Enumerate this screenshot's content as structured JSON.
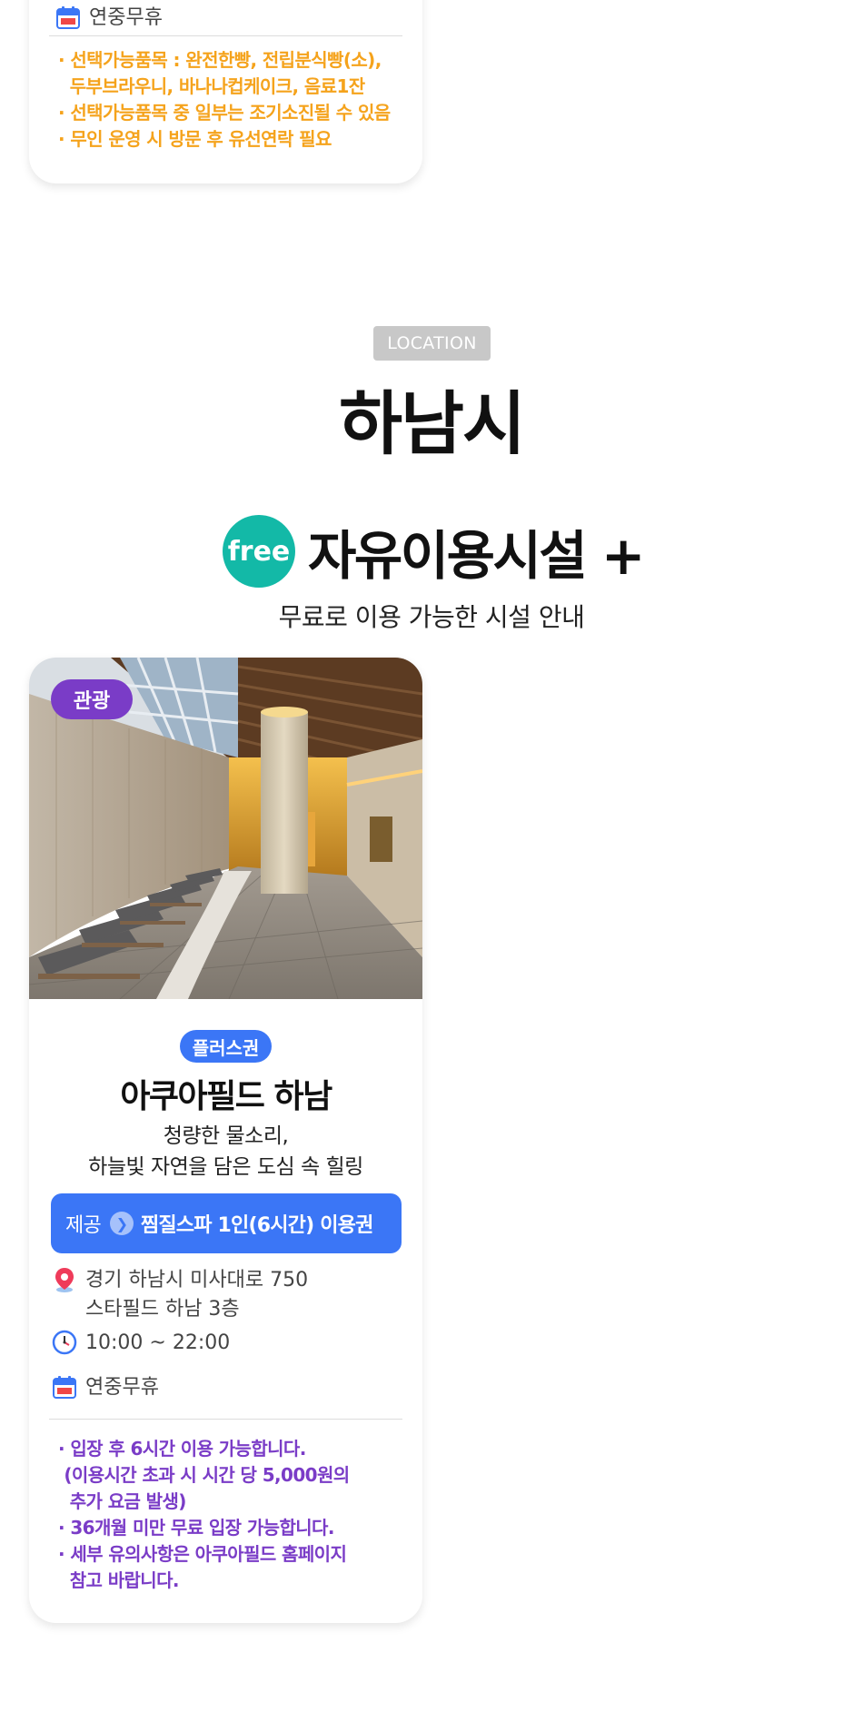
{
  "top_card": {
    "closed_text": "연중무휴",
    "notes": [
      "· 선택가능품목 : 완전한빵, 전립분식빵(소),",
      "  두부브라우니, 바나나컵케이크, 음료1잔",
      "· 선택가능품목 중 일부는 조기소진될 수 있음",
      "· 무인 운영 시 방문 후 유선연락 필요"
    ],
    "note_color": "#f5a31c"
  },
  "location": {
    "badge": "LOCATION",
    "city": "하남시"
  },
  "free_section": {
    "badge": "free",
    "title": "자유이용시설 +",
    "subtitle": "무료로 이용 가능한 시설 안내",
    "accent": "#13b9a7"
  },
  "facility": {
    "category": "관광",
    "pass_type": "플러스권",
    "name": "아쿠아필드 하남",
    "desc_line1": "청량한 물소리,",
    "desc_line2": "하늘빛 자연을 담은 도심 속 힐링",
    "provide_label": "제공",
    "provide_value": "찜질스파 1인(6시간) 이용권",
    "address_line1": "경기 하남시 미사대로 750",
    "address_line2": "스타필드 하남 3층",
    "hours": "10:00 ~ 22:00",
    "closed": "연중무휴",
    "notes": [
      "· 입장 후 6시간 이용 가능합니다.",
      " (이용시간 초과 시 시간 당 5,000원의",
      "  추가 요금 발생)",
      "· 36개월 미만 무료 입장 가능합니다.",
      "· 세부 유의사항은 아쿠아필드 홈페이지",
      "  참고 바랍니다."
    ],
    "category_color": "#7a3cc7",
    "pass_color": "#3b76f6"
  }
}
